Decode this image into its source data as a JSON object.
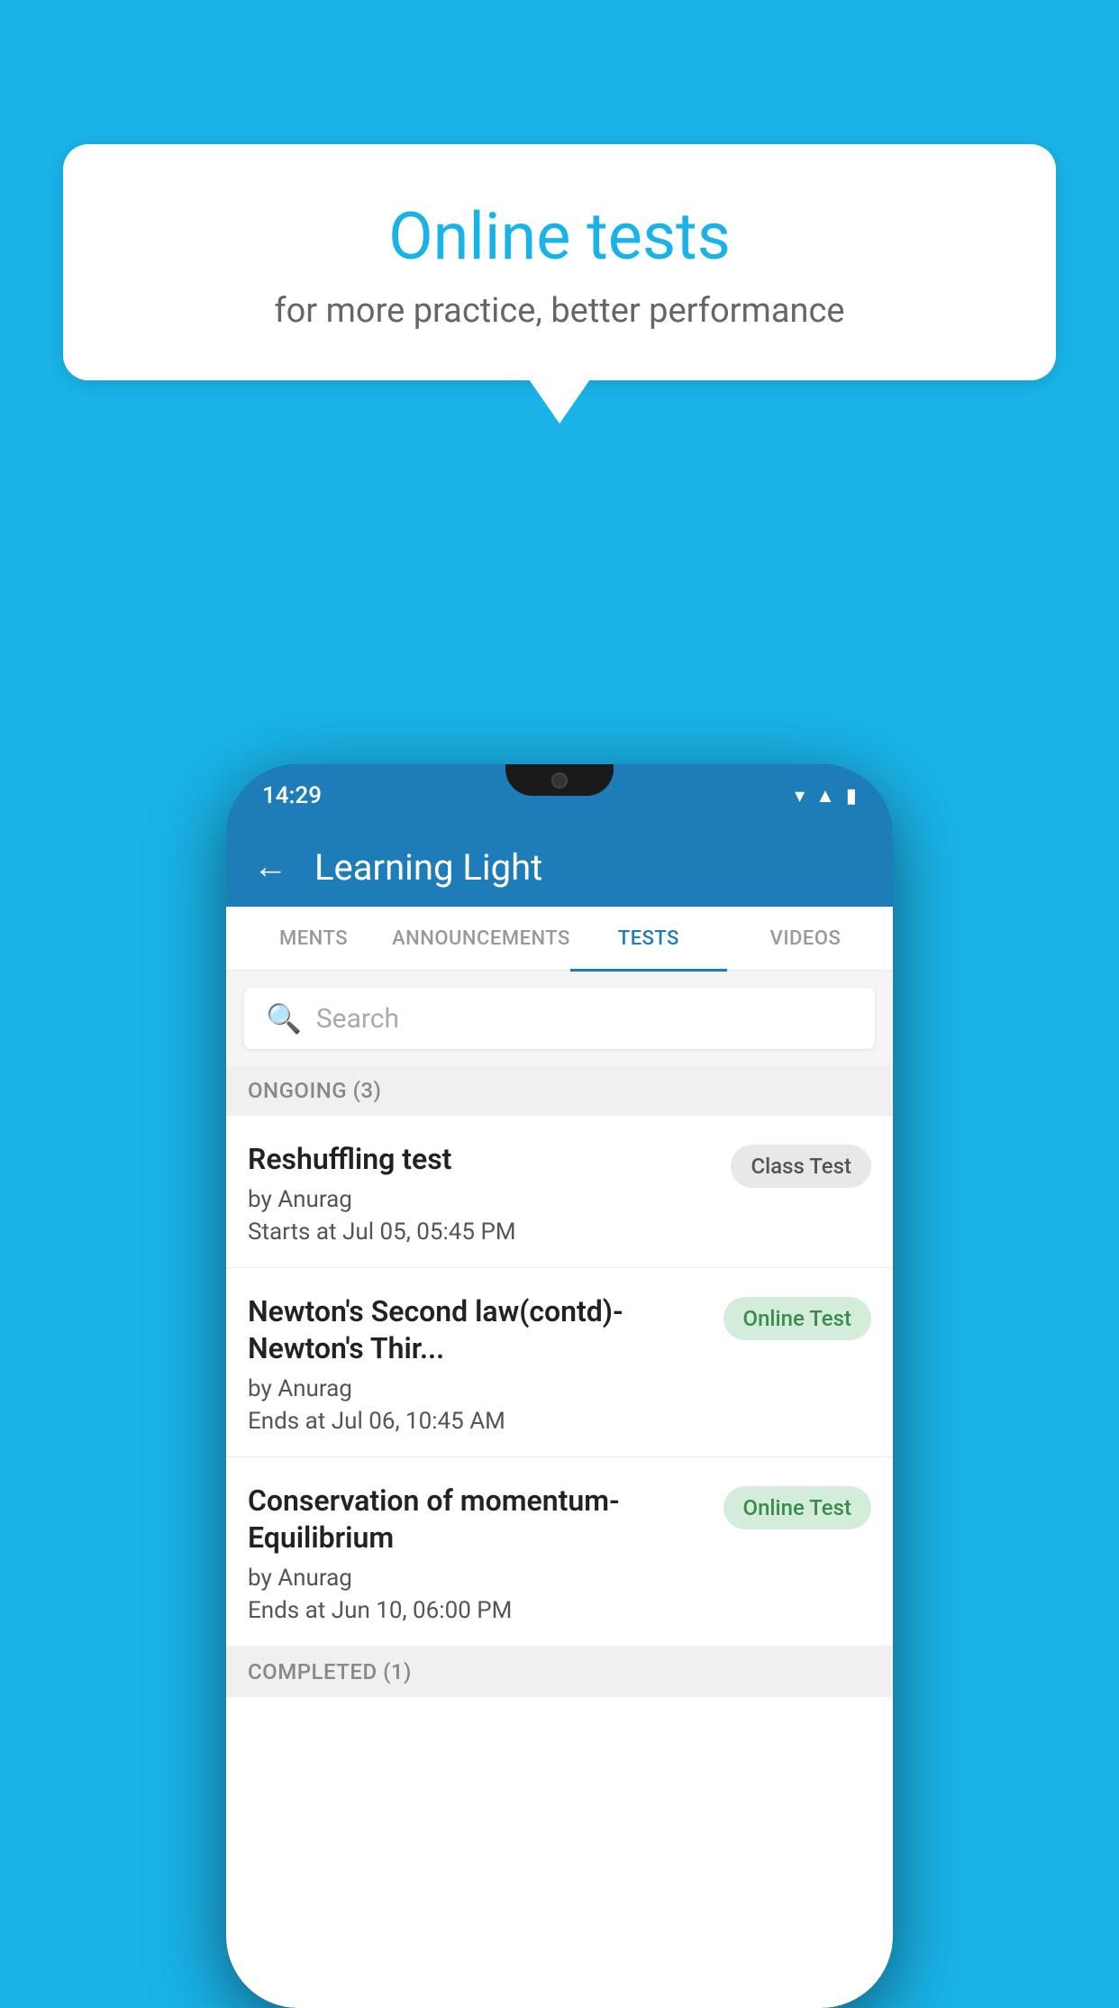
{
  "background": {
    "color": "#1ab3e8"
  },
  "bubble": {
    "title": "Online tests",
    "subtitle": "for more practice, better performance"
  },
  "phone": {
    "status_bar": {
      "time": "14:29"
    },
    "header": {
      "title": "Learning Light",
      "back_label": "←"
    },
    "tabs": [
      {
        "label": "MENTS",
        "active": false
      },
      {
        "label": "ANNOUNCEMENTS",
        "active": false
      },
      {
        "label": "TESTS",
        "active": true
      },
      {
        "label": "VIDEOS",
        "active": false
      }
    ],
    "search": {
      "placeholder": "Search"
    },
    "ongoing_section": {
      "label": "ONGOING (3)"
    },
    "tests": [
      {
        "name": "Reshuffling test",
        "author": "by Anurag",
        "time_label": "Starts at",
        "time": "Jul 05, 05:45 PM",
        "badge": "Class Test",
        "badge_type": "class"
      },
      {
        "name": "Newton's Second law(contd)-Newton's Thir...",
        "author": "by Anurag",
        "time_label": "Ends at",
        "time": "Jul 06, 10:45 AM",
        "badge": "Online Test",
        "badge_type": "online"
      },
      {
        "name": "Conservation of momentum-Equilibrium",
        "author": "by Anurag",
        "time_label": "Ends at",
        "time": "Jun 10, 06:00 PM",
        "badge": "Online Test",
        "badge_type": "online"
      }
    ],
    "completed_section": {
      "label": "COMPLETED (1)"
    }
  }
}
